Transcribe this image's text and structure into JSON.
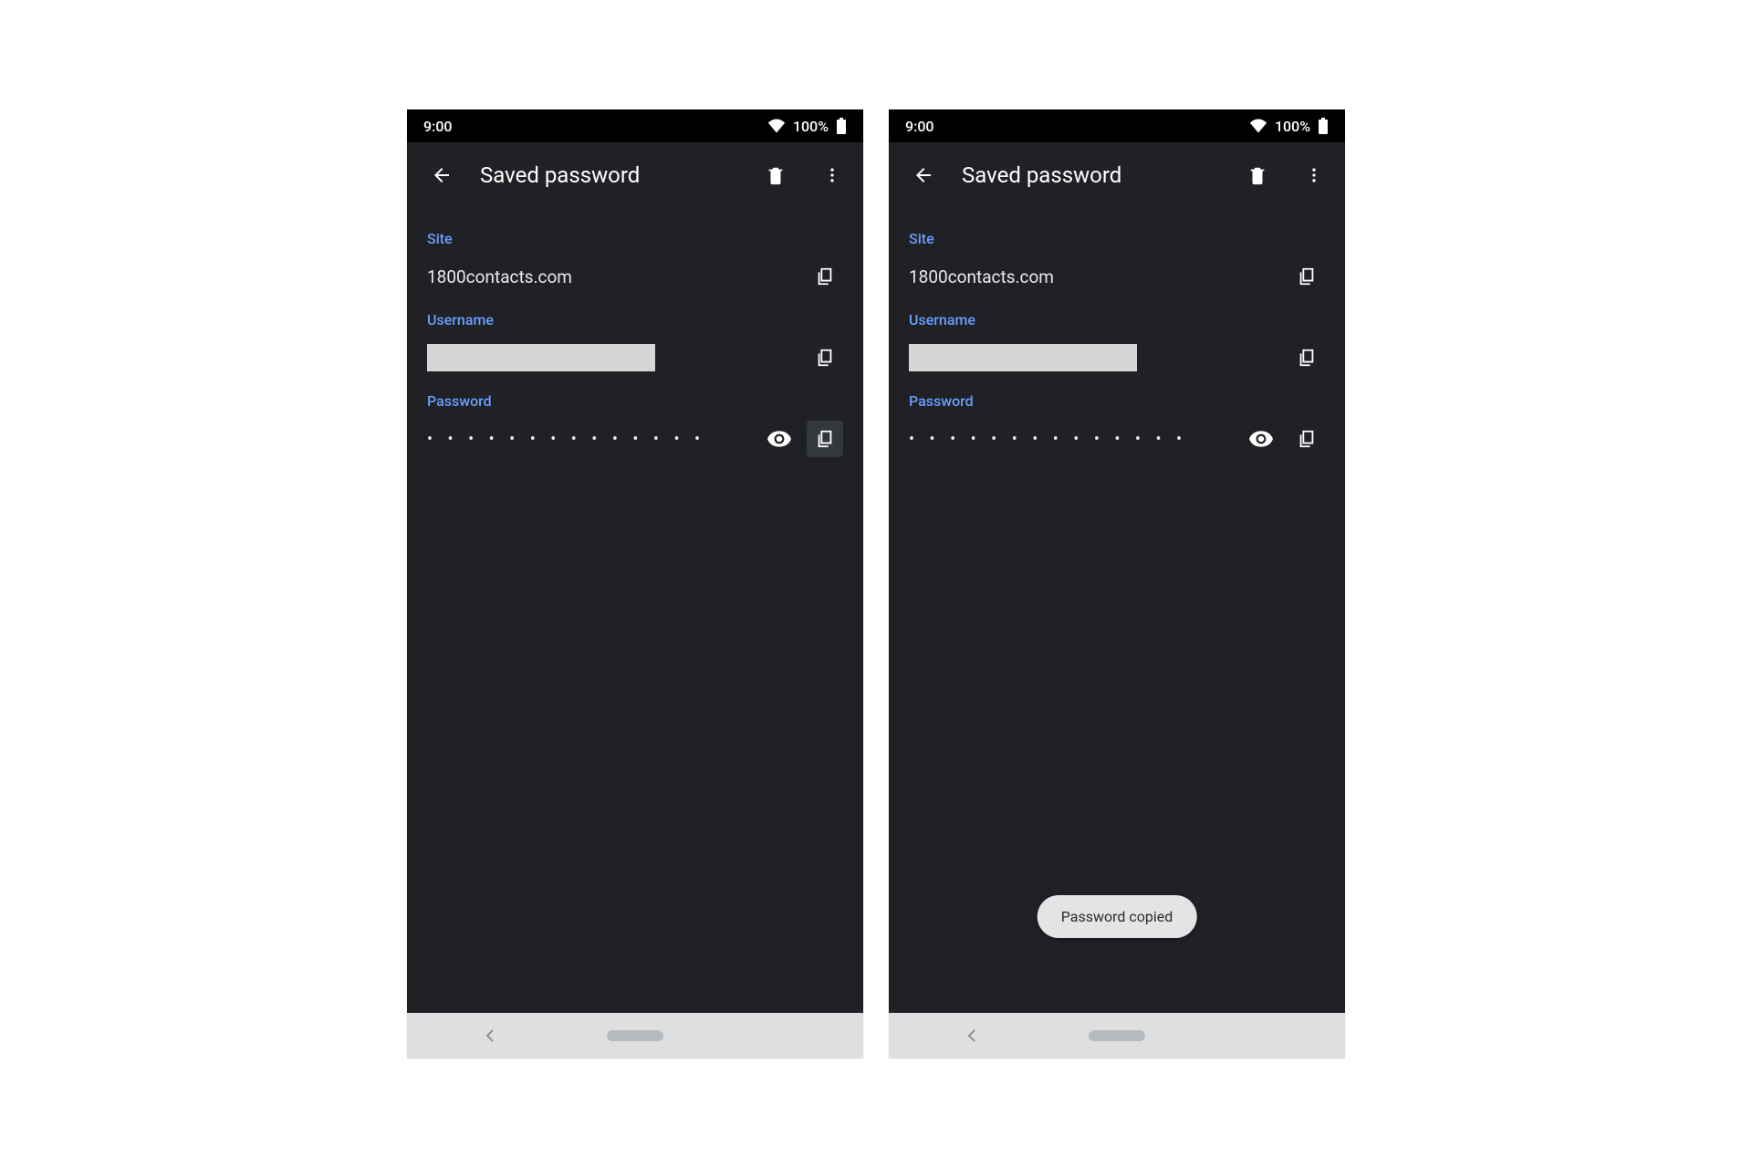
{
  "status": {
    "time": "9:00",
    "battery": "100%"
  },
  "appbar": {
    "title": "Saved password"
  },
  "labels": {
    "site": "Site",
    "username": "Username",
    "password": "Password"
  },
  "values": {
    "site": "1800contacts.com",
    "username": "",
    "password_masked": "• • • • • • • • • • • • • •"
  },
  "toast": {
    "password_copied": "Password copied"
  },
  "colors": {
    "accent": "#6a9dff",
    "bg": "#1f2125"
  }
}
